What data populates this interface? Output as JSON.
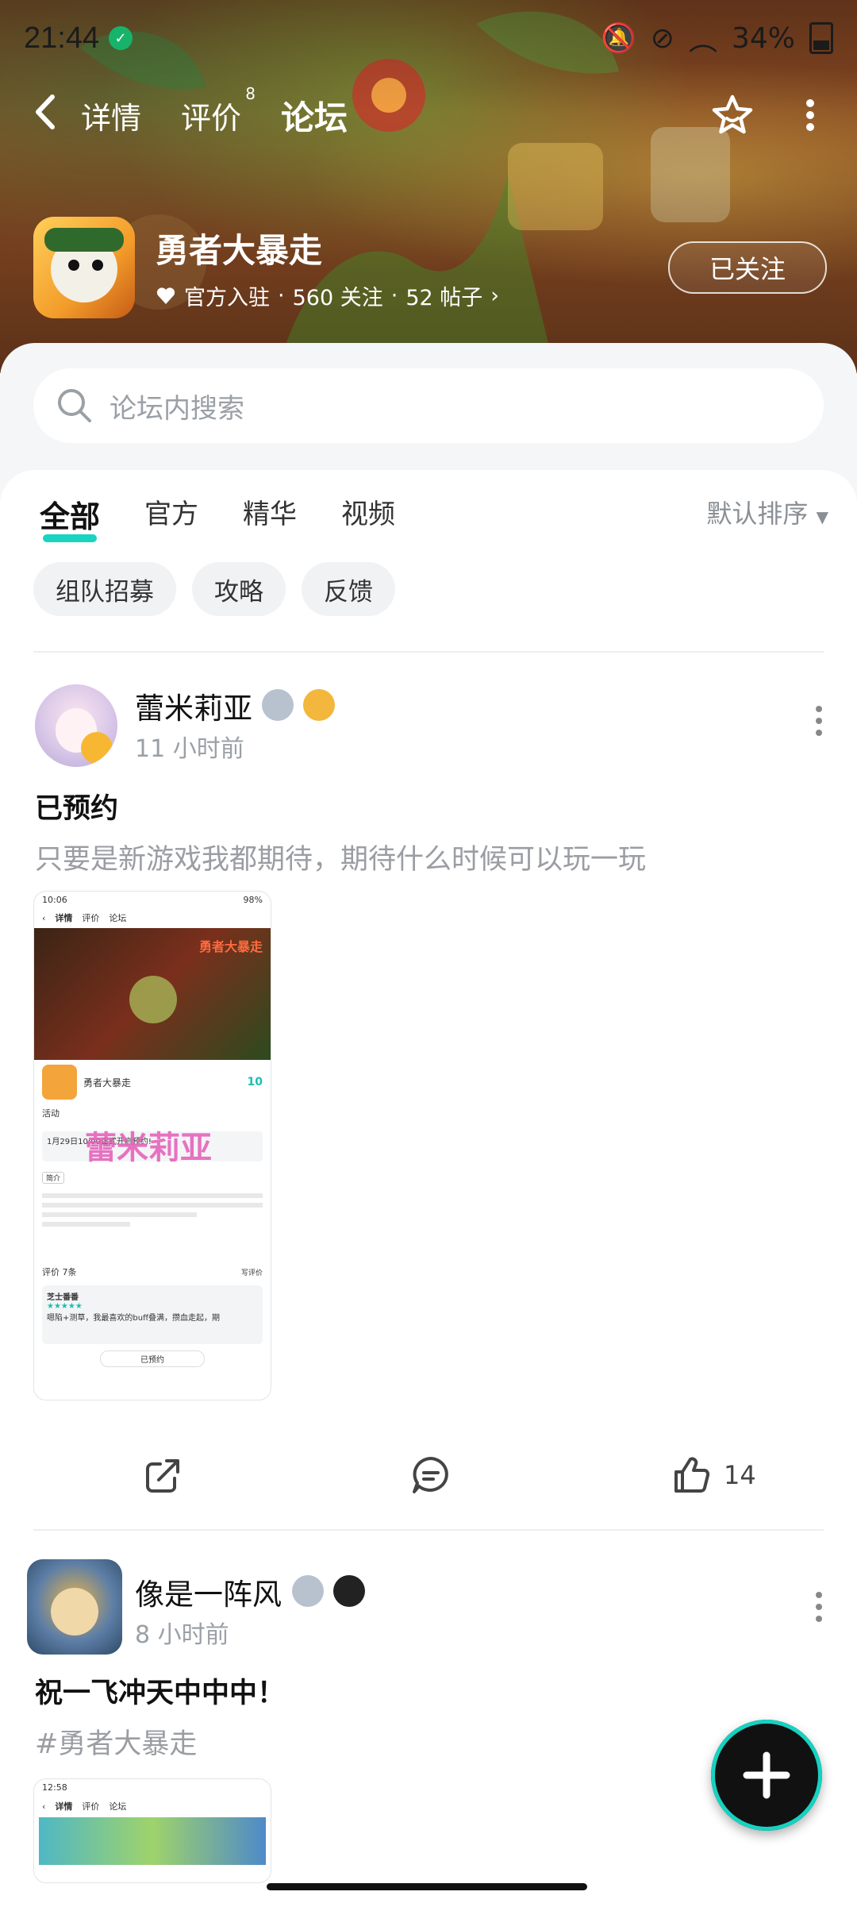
{
  "status_bar": {
    "time": "21:44",
    "battery": "34%"
  },
  "nav": {
    "tabs": [
      {
        "label": "详情"
      },
      {
        "label": "评价",
        "badge": "8"
      },
      {
        "label": "论坛"
      }
    ],
    "active_tab": "论坛"
  },
  "game": {
    "title": "勇者大暴走",
    "meta_official": "官方入驻",
    "meta_follow": "560 关注",
    "meta_posts": "52 帖子",
    "follow_button": "已关注"
  },
  "search": {
    "placeholder": "论坛内搜索"
  },
  "category_tabs": [
    "全部",
    "官方",
    "精华",
    "视频"
  ],
  "sort_label": "默认排序",
  "chips": [
    "组队招募",
    "攻略",
    "反馈"
  ],
  "posts": [
    {
      "user": "蕾米莉亚",
      "time": "11 小时前",
      "title": "已预约",
      "body": "只要是新游戏我都期待，期待什么时候可以玩一玩",
      "watermark": "蕾米莉亚",
      "likes": "14",
      "screenshot": {
        "time": "10:06",
        "battery": "98%",
        "tabs": [
          "详情",
          "评价",
          "论坛"
        ],
        "game_title": "勇者大暴走",
        "score": "10",
        "activity_label": "活动",
        "activity_text": "1月29日10:00正式开启预约!",
        "preview_label": "简介",
        "reviews_label": "评价 7条",
        "write_review": "写评价",
        "reviewer": "芝士番番",
        "review_text": "嗯陷+测草，我最喜欢的buff叠满，攒血走起，期",
        "reserved_button": "已预约"
      }
    },
    {
      "user": "像是一阵风",
      "time": "8 小时前",
      "title": "祝一飞冲天中中中！",
      "body": "#勇者大暴走",
      "screenshot": {
        "time": "12:58",
        "tabs": [
          "详情",
          "评价",
          "论坛"
        ]
      }
    }
  ],
  "colors": {
    "accent": "#19d4c0",
    "panel_bg": "#f4f6f8"
  }
}
